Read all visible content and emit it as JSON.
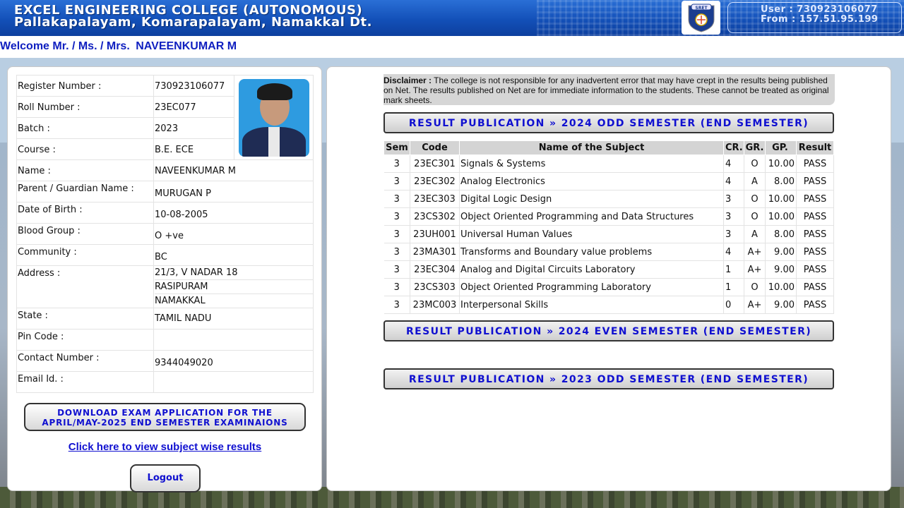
{
  "header": {
    "college_name": "EXCEL ENGINEERING COLLEGE (AUTONOMOUS)",
    "college_address": "Pallakapalayam, Komarapalayam, Namakkal Dt.",
    "logo_text": "SRET",
    "user_line": "User : 730923106077",
    "from_line": "From : 157.51.95.199"
  },
  "welcome": {
    "prefix": "Welcome Mr. / Ms. / Mrs.",
    "name": "NAVEENKUMAR M"
  },
  "student": {
    "register_number": {
      "label": "Register Number :",
      "value": "730923106077"
    },
    "roll_number": {
      "label": "Roll Number :",
      "value": "23EC077"
    },
    "batch": {
      "label": "Batch :",
      "value": "2023"
    },
    "course": {
      "label": "Course :",
      "value": "B.E. ECE"
    },
    "name": {
      "label": "Name :",
      "value": "NAVEENKUMAR M"
    },
    "parent": {
      "label": "Parent / Guardian Name :",
      "value": "MURUGAN P"
    },
    "dob": {
      "label": "Date of Birth :",
      "value": "10-08-2005"
    },
    "blood_group": {
      "label": "Blood Group :",
      "value": "O +ve"
    },
    "community": {
      "label": "Community :",
      "value": "BC"
    },
    "address": {
      "label": "Address :",
      "lines": [
        "21/3, V NADAR 18",
        "RASIPURAM",
        "NAMAKKAL"
      ]
    },
    "state": {
      "label": "State :",
      "value": "TAMIL NADU"
    },
    "pin_code": {
      "label": "Pin Code :",
      "value": ""
    },
    "contact": {
      "label": "Contact Number :",
      "value": "9344049020"
    },
    "email": {
      "label": "Email Id. :",
      "value": ""
    }
  },
  "actions": {
    "download_line1": "DOWNLOAD EXAM APPLICATION FOR THE",
    "download_line2": "APRIL/MAY-2025 END SEMESTER EXAMINAIONS",
    "subject_link": "Click here to view subject wise results",
    "logout": "Logout"
  },
  "disclaimer": {
    "label": "Disclaimer :",
    "text": "The college is not responsible for any inadvertent error that may have crept in the results being published on Net. The results published on Net are for immediate information to the students. These cannot be treated as original mark sheets."
  },
  "results": {
    "publications": [
      "RESULT PUBLICATION  » 2024 ODD SEMESTER (END SEMESTER)",
      "RESULT PUBLICATION  » 2024 EVEN SEMESTER (END SEMESTER)",
      "RESULT PUBLICATION  » 2023 ODD SEMESTER (END SEMESTER)"
    ],
    "columns": [
      "Sem",
      "Code",
      "Name of the Subject",
      "CR.",
      "GR.",
      "GP.",
      "Result"
    ],
    "rows": [
      [
        "3",
        "23EC301",
        "Signals & Systems",
        "4",
        "O",
        "10.00",
        "PASS"
      ],
      [
        "3",
        "23EC302",
        "Analog Electronics",
        "4",
        "A",
        "8.00",
        "PASS"
      ],
      [
        "3",
        "23EC303",
        "Digital Logic Design",
        "3",
        "O",
        "10.00",
        "PASS"
      ],
      [
        "3",
        "23CS302",
        "Object Oriented Programming and Data Structures",
        "3",
        "O",
        "10.00",
        "PASS"
      ],
      [
        "3",
        "23UH001",
        "Universal Human Values",
        "3",
        "A",
        "8.00",
        "PASS"
      ],
      [
        "3",
        "23MA301",
        "Transforms and Boundary value problems",
        "4",
        "A+",
        "9.00",
        "PASS"
      ],
      [
        "3",
        "23EC304",
        "Analog and Digital Circuits Laboratory",
        "1",
        "A+",
        "9.00",
        "PASS"
      ],
      [
        "3",
        "23CS303",
        "Object Oriented Programming Laboratory",
        "1",
        "O",
        "10.00",
        "PASS"
      ],
      [
        "3",
        "23MC003",
        "Interpersonal Skills",
        "0",
        "A+",
        "9.00",
        "PASS"
      ]
    ]
  },
  "colors": {
    "header_blue": "#1350b8",
    "link_blue": "#1010d0",
    "table_header_gray": "#d4d4d4"
  }
}
